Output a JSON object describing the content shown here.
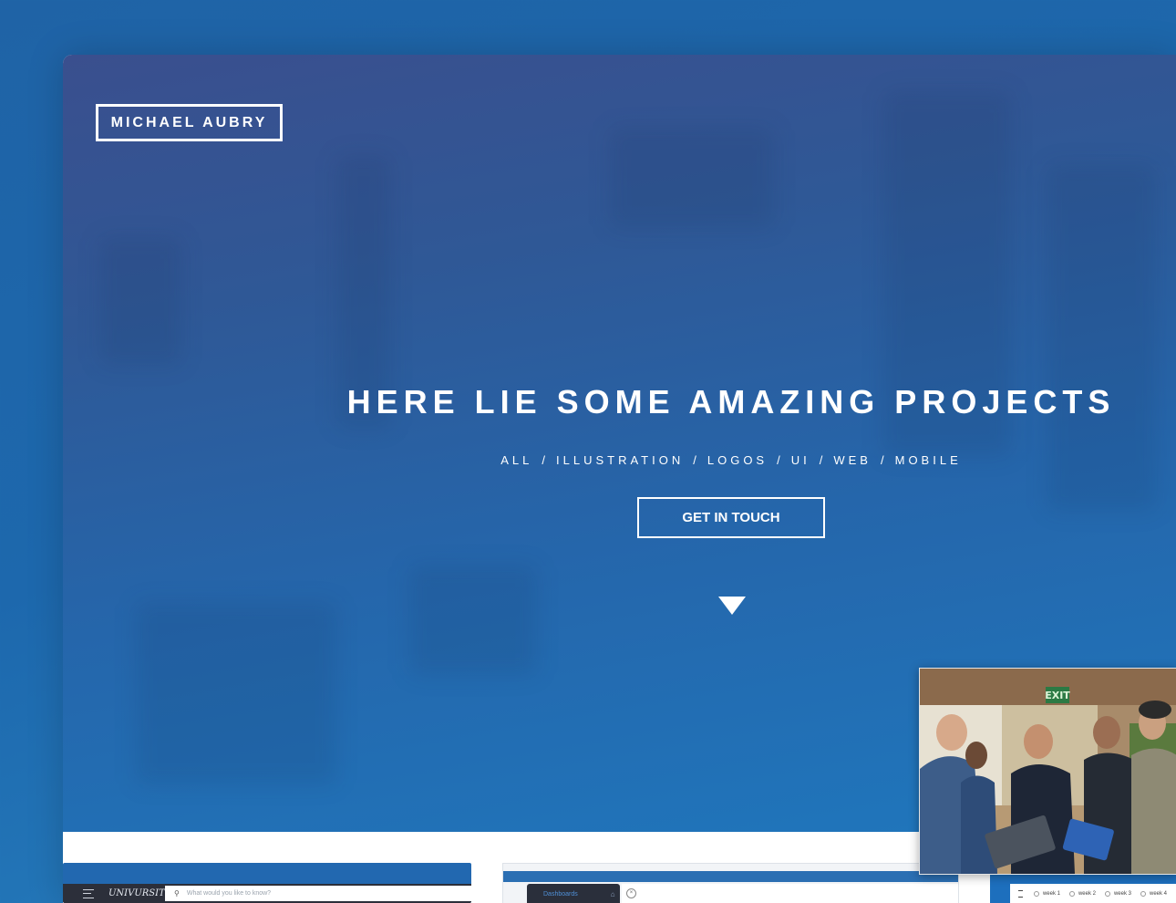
{
  "site": {
    "logo_text": "MICHAEL AUBRY"
  },
  "hero": {
    "headline": "HERE LIE SOME AMAZING PROJECTS",
    "filters": [
      "ALL",
      "ILLUSTRATION",
      "LOGOS",
      "UI",
      "WEB",
      "MOBILE"
    ],
    "separator": "/",
    "cta_label": "GET IN TOUCH",
    "scroll_icon": "triangle-down-icon"
  },
  "previews": {
    "card1": {
      "brand": "UNIVURSITY",
      "search_placeholder": "What would you like to know?"
    },
    "card2": {
      "sidebar_label": "Dashboards"
    },
    "card3": {
      "weeks": [
        "week 1",
        "week 2",
        "week 3",
        "week 4"
      ]
    }
  },
  "photo": {
    "exit_sign": "EXIT"
  },
  "colors": {
    "background": "#1d68ad",
    "hero_top": "#3a4f8e",
    "hero_bottom": "#1f77bd",
    "text": "#ffffff"
  }
}
